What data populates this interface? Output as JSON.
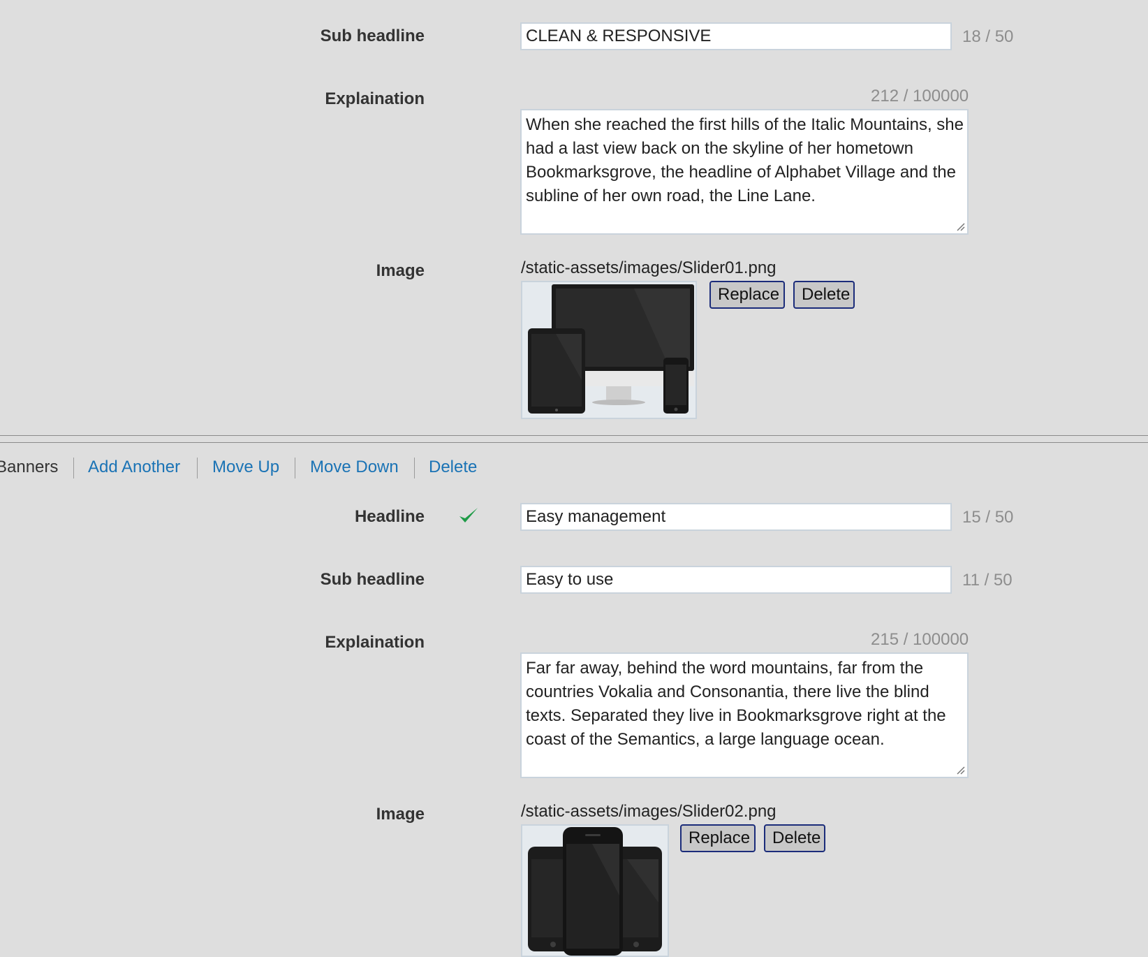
{
  "banner1": {
    "sub_headline_label": "Sub headline",
    "sub_headline_value": "CLEAN & RESPONSIVE",
    "sub_headline_count": "18 / 50",
    "explanation_label": "Explaination",
    "explanation_count": "212 / 100000",
    "explanation_value": "When she reached the first hills of the Italic Mountains, she had a last view back on the skyline of her hometown Bookmarksgrove, the headline of Alphabet Village and the subline of her own road, the Line Lane.",
    "image_label": "Image",
    "image_path": "/static-assets/images/Slider01.png",
    "replace_label": "Replace",
    "delete_label": "Delete"
  },
  "toolbar": {
    "section_title": "Banners",
    "add_another": "Add Another",
    "move_up": "Move Up",
    "move_down": "Move Down",
    "delete": "Delete"
  },
  "banner2": {
    "headline_label": "Headline",
    "headline_value": "Easy management",
    "headline_count": "15 / 50",
    "sub_headline_label": "Sub headline",
    "sub_headline_value": "Easy to use",
    "sub_headline_count": "11 / 50",
    "explanation_label": "Explaination",
    "explanation_count": "215 / 100000",
    "explanation_value": "Far far away, behind the word mountains, far from the countries Vokalia and Consonantia, there live the blind texts. Separated they live in Bookmarksgrove right at the coast of the Semantics, a large language ocean.",
    "image_label": "Image",
    "image_path": "/static-assets/images/Slider02.png",
    "replace_label": "Replace",
    "delete_label": "Delete"
  },
  "icons": {
    "valid": "checkmark-icon",
    "resize": "resize-grip-icon",
    "devices_image": "devices-thumbnail",
    "phones_image": "phones-thumbnail"
  },
  "colors": {
    "background": "#dedede",
    "link": "#1a73b5",
    "check": "#1e9b47",
    "button_border": "#1b2c7a",
    "counter": "#8d8d8d"
  }
}
